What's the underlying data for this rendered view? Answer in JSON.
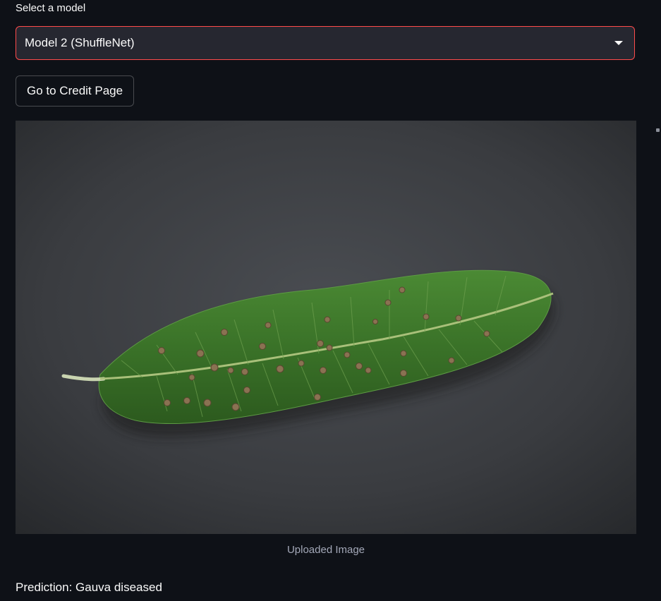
{
  "model_select": {
    "label": "Select a model",
    "selected": "Model 2 (ShuffleNet)"
  },
  "credit_button": {
    "label": "Go to Credit Page"
  },
  "image": {
    "caption": "Uploaded Image"
  },
  "result": {
    "prediction_text": "Prediction: Gauva diseased"
  },
  "colors": {
    "background": "#0e1117",
    "accent": "#ff4b4b",
    "input_bg": "#262730",
    "leaf": "#3d7a2c"
  }
}
